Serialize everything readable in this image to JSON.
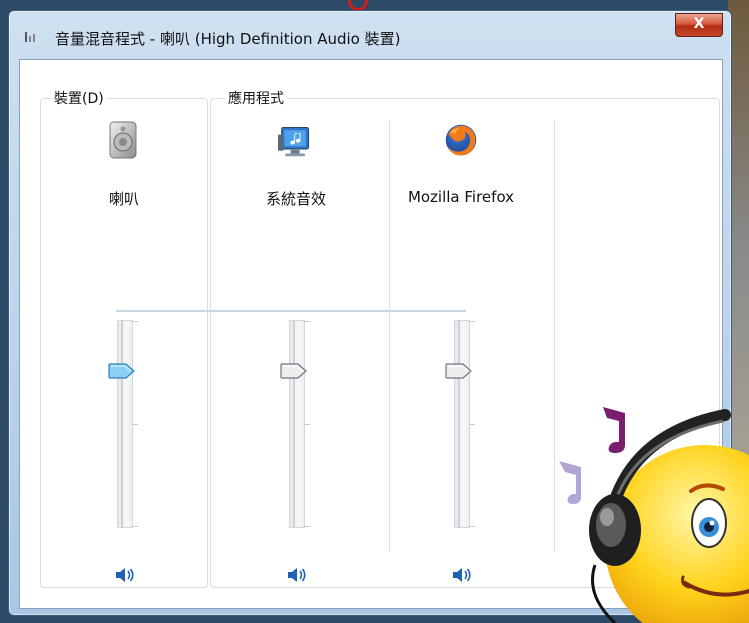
{
  "window": {
    "title": "音量混音程式 - 喇叭 (High Definition Audio 裝置)",
    "close_label": "X"
  },
  "groups": {
    "device_label": "裝置(D)",
    "apps_label": "應用程式"
  },
  "channels": [
    {
      "label": "喇叭",
      "icon": "speaker-device-icon",
      "volume": 0.75,
      "muted": false
    },
    {
      "label": "系統音效",
      "icon": "system-sounds-icon",
      "volume": 0.75,
      "muted": false
    },
    {
      "label": "Mozilla Firefox",
      "icon": "firefox-icon",
      "volume": 0.75,
      "muted": false
    }
  ],
  "colors": {
    "titlebar": "#b9d1ea",
    "close_button": "#c8452a",
    "thumb_active": "#6fb8ea",
    "mute_icon": "#1d62b4",
    "smiley": "#ffd21a"
  }
}
